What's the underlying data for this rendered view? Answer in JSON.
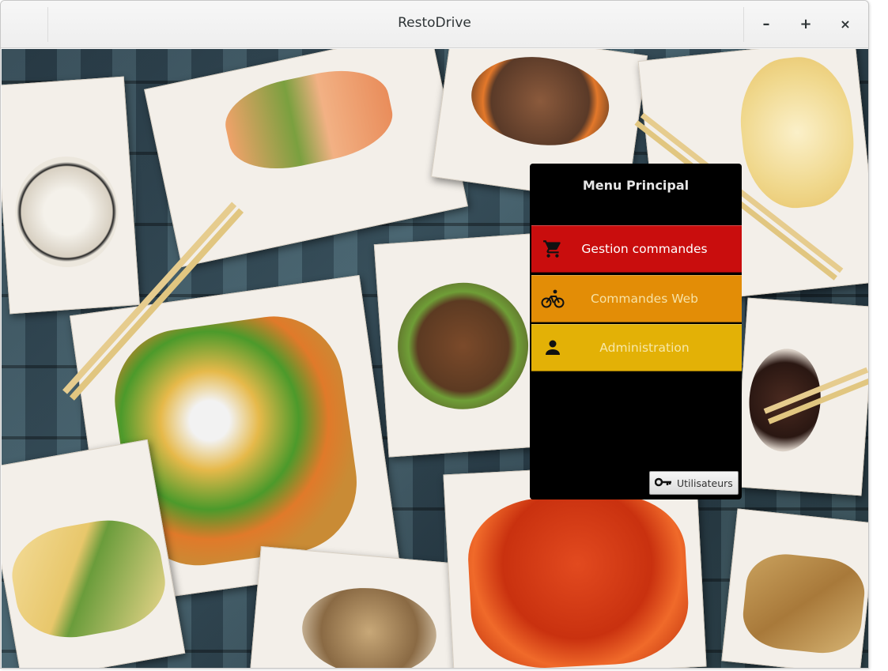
{
  "window": {
    "title": "RestoDrive",
    "controls": {
      "minimize": "–",
      "maximize": "+",
      "close": "×"
    }
  },
  "menu": {
    "header": "Menu Principal",
    "items": [
      {
        "label": "Gestion commandes",
        "icon": "cart-icon",
        "color": "#c90d0d"
      },
      {
        "label": "Commandes Web",
        "icon": "bicycle-icon",
        "color": "#e38d06"
      },
      {
        "label": "Administration",
        "icon": "person-icon",
        "color": "#e3b106"
      }
    ],
    "users_button": {
      "label": "Utilisateurs",
      "icon": "key-icon"
    }
  }
}
